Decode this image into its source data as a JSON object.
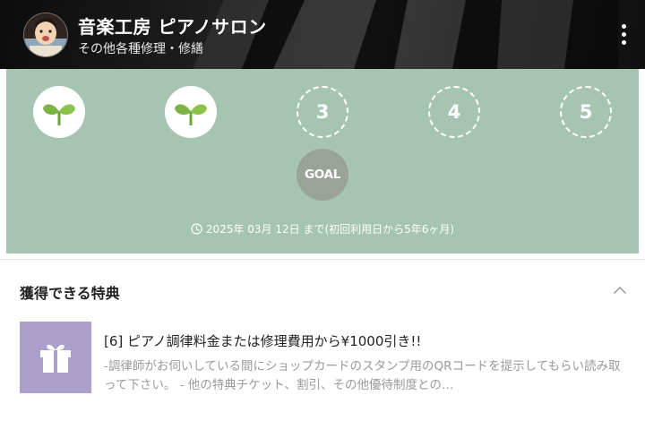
{
  "header": {
    "shop_name": "音楽工房 ピアノサロン",
    "category": "その他各種修理・修繕",
    "menu_icon": "more-vertical-icon"
  },
  "stamp_card": {
    "stamps": [
      {
        "label": "",
        "collected": true,
        "icon": "sprout-icon"
      },
      {
        "label": "",
        "collected": true,
        "icon": "sprout-icon"
      },
      {
        "label": "3",
        "collected": false
      },
      {
        "label": "4",
        "collected": false
      },
      {
        "label": "5",
        "collected": false
      }
    ],
    "goal_label": "GOAL",
    "expiry_text": "2025年 03月 12日 まで(初回利用日から5年6ヶ月)",
    "colors": {
      "panel": "#a5c4b1",
      "goal": "#99a398",
      "sprout": "#7cb342"
    }
  },
  "benefits": {
    "section_title": "獲得できる特典",
    "items": [
      {
        "title": "[6] ピアノ調律料金または修理費用から¥1000引き!!",
        "description": "-調律師がお伺いしている間にショップカードのスタンプ用のQRコードを提示してもらい読み取って下さい。 - 他の特典チケット、割引、その他優待制度との…",
        "icon": "gift-icon",
        "thumb_color": "#ac9fca"
      }
    ]
  }
}
